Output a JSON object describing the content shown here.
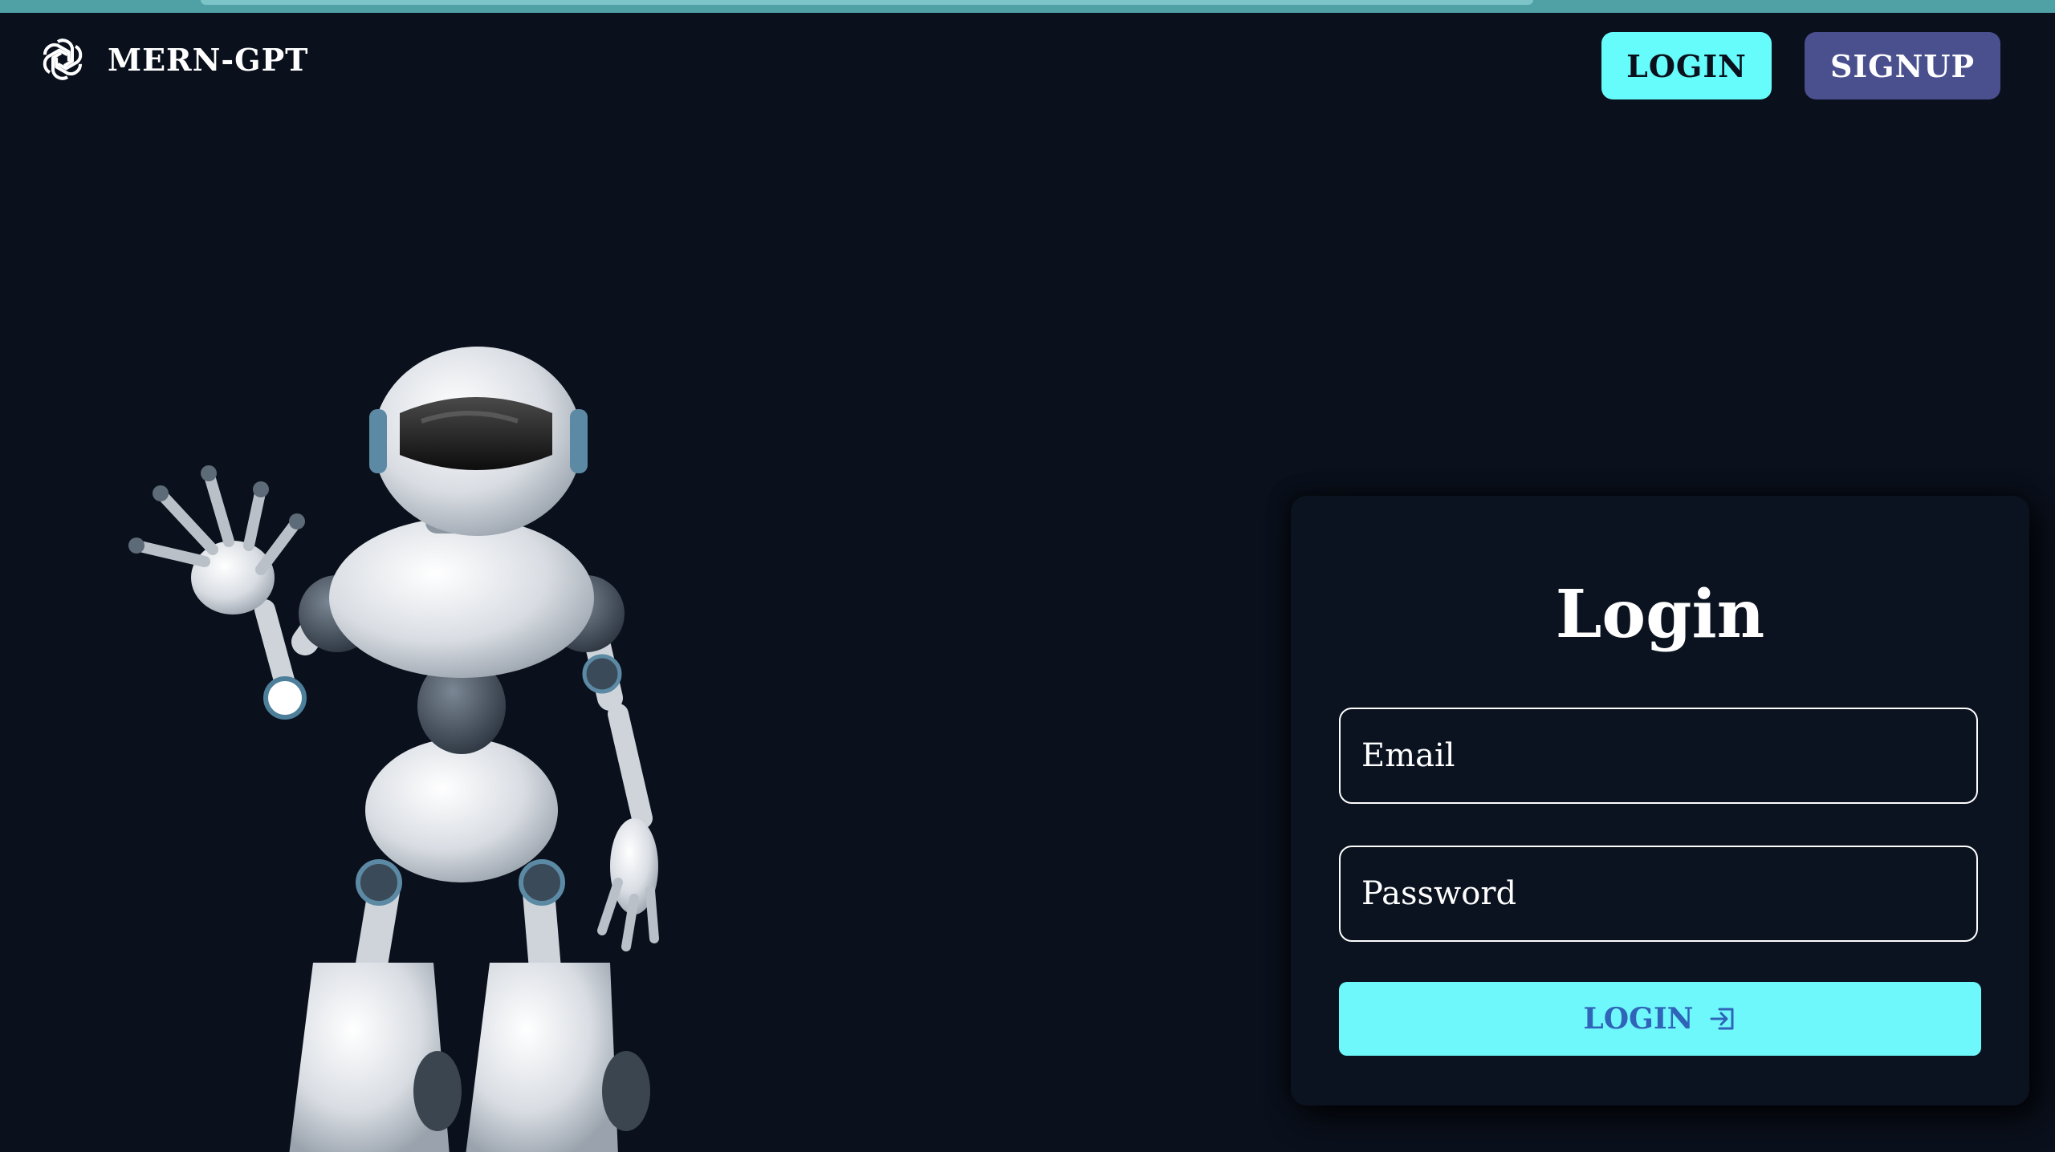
{
  "header": {
    "brand": "MERN-GPT",
    "logo_icon": "openai-logo-icon",
    "login_label": "LOGIN",
    "signup_label": "SIGNUP"
  },
  "illustration": {
    "icon": "waving-robot-illustration"
  },
  "login_form": {
    "title": "Login",
    "email_placeholder": "Email",
    "password_placeholder": "Password",
    "submit_label": "LOGIN",
    "submit_icon": "login-arrow-icon"
  },
  "colors": {
    "background": "#0a101c",
    "accent_cyan": "#66fcfc",
    "signup_purple": "#4a4f8e",
    "submit_text": "#2f64b8"
  }
}
